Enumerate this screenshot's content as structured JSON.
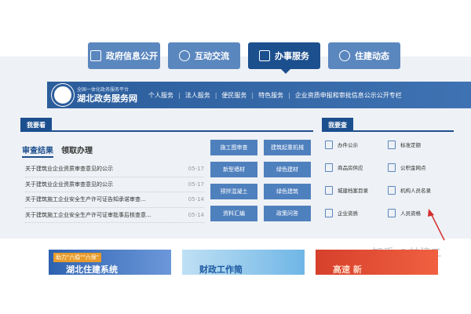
{
  "top_tabs": [
    {
      "label": "政府信息公开",
      "icon": "document-icon"
    },
    {
      "label": "互动交流",
      "icon": "chat-icon"
    },
    {
      "label": "办事服务",
      "icon": "screen-icon",
      "active": true
    },
    {
      "label": "住建动态",
      "icon": "person-icon"
    }
  ],
  "banner": {
    "logo_small": "全国一体化政务服务平台",
    "logo_big": "湖北政务服务网",
    "nav": [
      "个人服务",
      "法人服务",
      "便民服务",
      "特色服务",
      "企业资质申报和审批信息公示公开专栏"
    ]
  },
  "left_section": {
    "title": "我要看",
    "sub_tabs": [
      "审查结果",
      "领取办理"
    ],
    "news": [
      {
        "title": "关于建筑业企业资质审查意见的公示",
        "date": "05-17"
      },
      {
        "title": "关于建筑业企业资质审查意见的公示",
        "date": "05-17"
      },
      {
        "title": "关于建筑施工企业安全生产许可证告知承诺审查...",
        "date": "05-14"
      },
      {
        "title": "关于建筑施工企业安全生产许可证审批事后核查意...",
        "date": "05-14"
      }
    ],
    "buttons": [
      "施工图审查",
      "建筑起重机械",
      "新型墙材",
      "绿色建材",
      "预拌混凝土",
      "绿色建筑",
      "资料汇编",
      "政策问答"
    ]
  },
  "right_section": {
    "title": "我要查",
    "items": [
      "办件公示",
      "标准定额",
      "商品房供应",
      "公积金网点",
      "城建档案目录",
      "机构人员名录",
      "企业资质",
      "人员资格"
    ]
  },
  "watermark": "知乎 @甘建二",
  "thumbs": [
    {
      "caption": "助力\"六稳\"\"六保\"",
      "text": "湖北住建系统"
    },
    {
      "caption": "",
      "text": "财政工作简"
    },
    {
      "caption": "",
      "text": "高速  新"
    }
  ]
}
